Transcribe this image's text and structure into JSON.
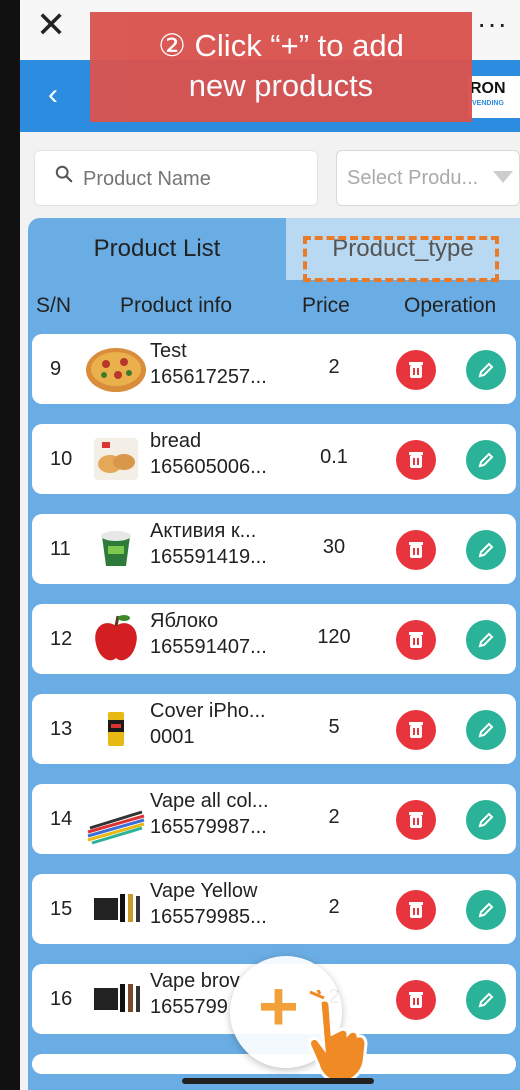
{
  "topbar": {
    "close_icon": "close-icon",
    "more_label": "···"
  },
  "header": {
    "back_label": "‹",
    "logo_main": "RON",
    "logo_sub": "VENDING"
  },
  "annotation": {
    "line1": "② Click “+” to add",
    "line2": "new products"
  },
  "filters": {
    "search_placeholder": "Product Name",
    "select_placeholder": "Select Produ..."
  },
  "tabs": {
    "product_list": "Product List",
    "product_type": "Product_type"
  },
  "columns": {
    "sn": "S/N",
    "info": "Product info",
    "price": "Price",
    "operation": "Operation"
  },
  "products": [
    {
      "sn": "9",
      "name": "Test",
      "code": "165617257...",
      "price": "2",
      "thumb": "pizza"
    },
    {
      "sn": "10",
      "name": "bread",
      "code": "165605006...",
      "price": "0.1",
      "thumb": "bread"
    },
    {
      "sn": "11",
      "name": "Активия к...",
      "code": "165591419...",
      "price": "30",
      "thumb": "yogurt"
    },
    {
      "sn": "12",
      "name": "Яблоко",
      "code": "165591407...",
      "price": "120",
      "thumb": "apple"
    },
    {
      "sn": "13",
      "name": "Cover iPho...",
      "code": "0001",
      "price": "5",
      "thumb": "drink-can"
    },
    {
      "sn": "14",
      "name": "Vape all col...",
      "code": "165579987...",
      "price": "2",
      "thumb": "vape-pens"
    },
    {
      "sn": "15",
      "name": "Vape Yellow",
      "code": "165579985...",
      "price": "2",
      "thumb": "vape-box"
    },
    {
      "sn": "16",
      "name": "Vape brov",
      "code": "1655799",
      "price": "2",
      "thumb": "vape-box"
    }
  ],
  "add_button": {
    "label": "+"
  },
  "colors": {
    "header_blue": "#2c8ce0",
    "list_blue": "#6aade4",
    "delete_red": "#e8343c",
    "edit_teal": "#2bb39a",
    "callout_red": "#d9534f",
    "highlight_orange": "#e87a29"
  }
}
